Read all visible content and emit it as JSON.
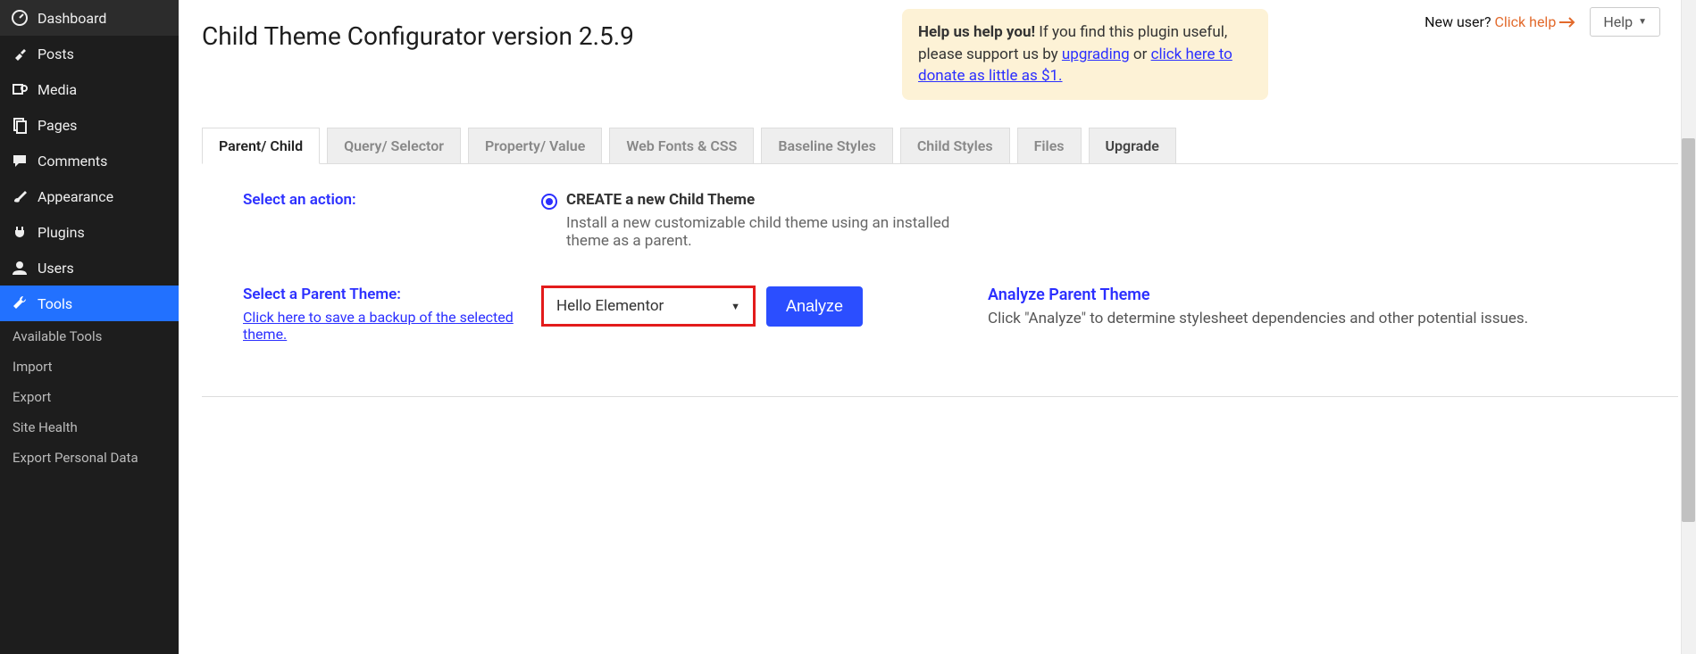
{
  "sidebar": {
    "items": [
      {
        "label": "Dashboard"
      },
      {
        "label": "Posts"
      },
      {
        "label": "Media"
      },
      {
        "label": "Pages"
      },
      {
        "label": "Comments"
      },
      {
        "label": "Appearance"
      },
      {
        "label": "Plugins"
      },
      {
        "label": "Users"
      },
      {
        "label": "Tools"
      }
    ],
    "subs": [
      "Available Tools",
      "Import",
      "Export",
      "Site Health",
      "Export Personal Data"
    ]
  },
  "page": {
    "title": "Child Theme Configurator version 2.5.9"
  },
  "topright": {
    "new_user": "New user?",
    "click_help": "Click help",
    "help": "Help"
  },
  "support": {
    "bold": "Help us help you!",
    "text_1": " If you find this plugin useful, please support us by ",
    "upgrade": "upgrading",
    "text_2": " or ",
    "donate": "click here to donate as little as $1."
  },
  "tabs": [
    "Parent/ Child",
    "Query/ Selector",
    "Property/ Value",
    "Web Fonts & CSS",
    "Baseline Styles",
    "Child Styles",
    "Files",
    "Upgrade"
  ],
  "action": {
    "label": "Select an action:",
    "radio_title": "CREATE a new Child Theme",
    "radio_desc": "Install a new customizable child theme using an installed theme as a parent."
  },
  "parent": {
    "label": "Select a Parent Theme:",
    "backup_link": "Click here to save a backup of the selected theme.",
    "selected": "Hello Elementor",
    "analyze_btn": "Analyze",
    "right_title": "Analyze Parent Theme",
    "right_desc": "Click \"Analyze\" to determine stylesheet dependencies and other potential issues."
  }
}
